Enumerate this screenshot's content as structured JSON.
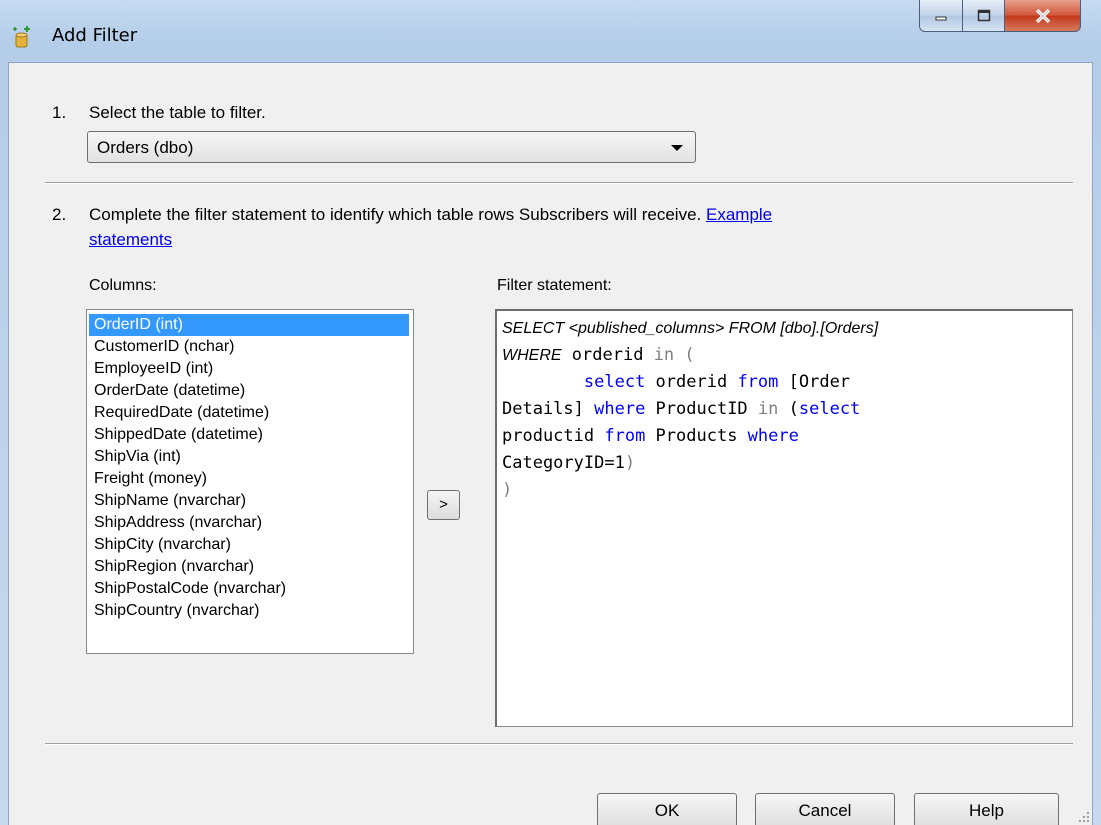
{
  "window": {
    "title": "Add Filter"
  },
  "step1": {
    "number": "1.",
    "text": "Select the table to filter.",
    "selected_table": "Orders (dbo)"
  },
  "step2": {
    "number": "2.",
    "text": "Complete the filter statement to identify which table rows Subscribers will receive.",
    "link_line1": "Example",
    "link_line2": "statements"
  },
  "columns": {
    "label": "Columns:",
    "items": [
      "OrderID (int)",
      "CustomerID (nchar)",
      "EmployeeID (int)",
      "OrderDate (datetime)",
      "RequiredDate (datetime)",
      "ShippedDate (datetime)",
      "ShipVia (int)",
      "Freight (money)",
      "ShipName (nvarchar)",
      "ShipAddress (nvarchar)",
      "ShipCity (nvarchar)",
      "ShipRegion (nvarchar)",
      "ShipPostalCode (nvarchar)",
      "ShipCountry (nvarchar)"
    ],
    "selected_index": 0
  },
  "add_button_label": ">",
  "filter": {
    "label": "Filter statement:",
    "select_prefix": "SELECT <published_columns> FROM [dbo].[Orders]",
    "where_keyword": "WHERE",
    "lines": [
      [
        [
          "t",
          " orderid "
        ],
        [
          "op",
          "in ("
        ]
      ],
      [
        [
          "t",
          "        "
        ],
        [
          "kw",
          "select"
        ],
        [
          "t",
          " orderid "
        ],
        [
          "kw",
          "from"
        ],
        [
          "t",
          " [Order"
        ]
      ],
      [
        [
          "t",
          "Details] "
        ],
        [
          "kw",
          "where"
        ],
        [
          "t",
          " ProductID "
        ],
        [
          "op",
          "in"
        ],
        [
          "t",
          " ("
        ],
        [
          "kw",
          "select"
        ]
      ],
      [
        [
          "t",
          "productid "
        ],
        [
          "kw",
          "from"
        ],
        [
          "t",
          " Products "
        ],
        [
          "kw",
          "where"
        ]
      ],
      [
        [
          "t",
          "CategoryID=1"
        ],
        [
          "op",
          ")"
        ]
      ],
      [
        [
          "op",
          ")"
        ]
      ]
    ]
  },
  "buttons": {
    "ok": "OK",
    "cancel": "Cancel",
    "help": "Help"
  }
}
